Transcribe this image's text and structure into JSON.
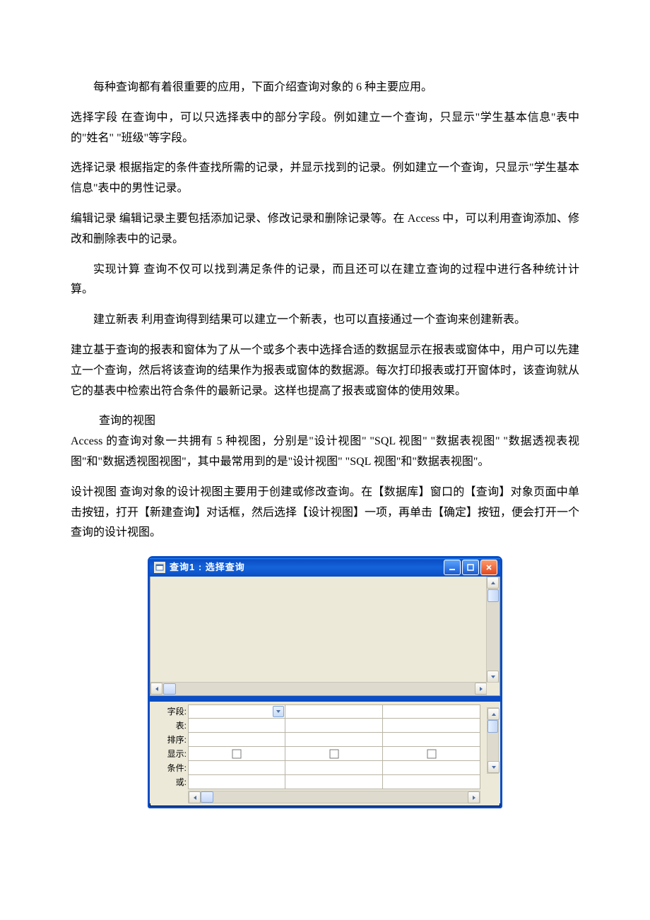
{
  "paragraphs": {
    "p1": "每种查询都有着很重要的应用，下面介绍查询对象的 6 种主要应用。",
    "p2": "选择字段 在查询中，可以只选择表中的部分字段。例如建立一个查询，只显示\"学生基本信息\"表中的\"姓名\" \"班级\"等字段。",
    "p3": "选择记录 根据指定的条件查找所需的记录，并显示找到的记录。例如建立一个查询，只显示\"学生基本信息\"表中的男性记录。",
    "p4": "编辑记录 编辑记录主要包括添加记录、修改记录和删除记录等。在 Access 中，可以利用查询添加、修改和删除表中的记录。",
    "p5": "实现计算 查询不仅可以找到满足条件的记录，而且还可以在建立查询的过程中进行各种统计计算。",
    "p6": "建立新表 利用查询得到结果可以建立一个新表，也可以直接通过一个查询来创建新表。",
    "p7": "建立基于查询的报表和窗体为了从一个或多个表中选择合适的数据显示在报表或窗体中，用户可以先建立一个查询，然后将该查询的结果作为报表或窗体的数据源。每次打印报表或打开窗体时，该查询就从它的基表中检索出符合条件的最新记录。这样也提高了报表或窗体的使用效果。",
    "s1": "查询的视图",
    "p8": "Access 的查询对象一共拥有 5 种视图，分别是\"设计视图\" \"SQL 视图\" \"数据表视图\" \"数据透视表视图\"和\"数据透视图视图\"，其中最常用到的是\"设计视图\" \"SQL 视图\"和\"数据表视图\"。",
    "p9": "设计视图 查询对象的设计视图主要用于创建或修改查询。在【数据库】窗口的【查询】对象页面中单击按钮，打开【新建查询】对话框，然后选择【设计视图】一项，再单击【确定】按钮，便会打开一个查询的设计视图。"
  },
  "access_window": {
    "title": "查询1  :  选择查询",
    "grid_rows": {
      "field": "字段:",
      "table": "表:",
      "sort": "排序:",
      "show": "显示:",
      "criteria": "条件:",
      "or": "或:"
    }
  }
}
